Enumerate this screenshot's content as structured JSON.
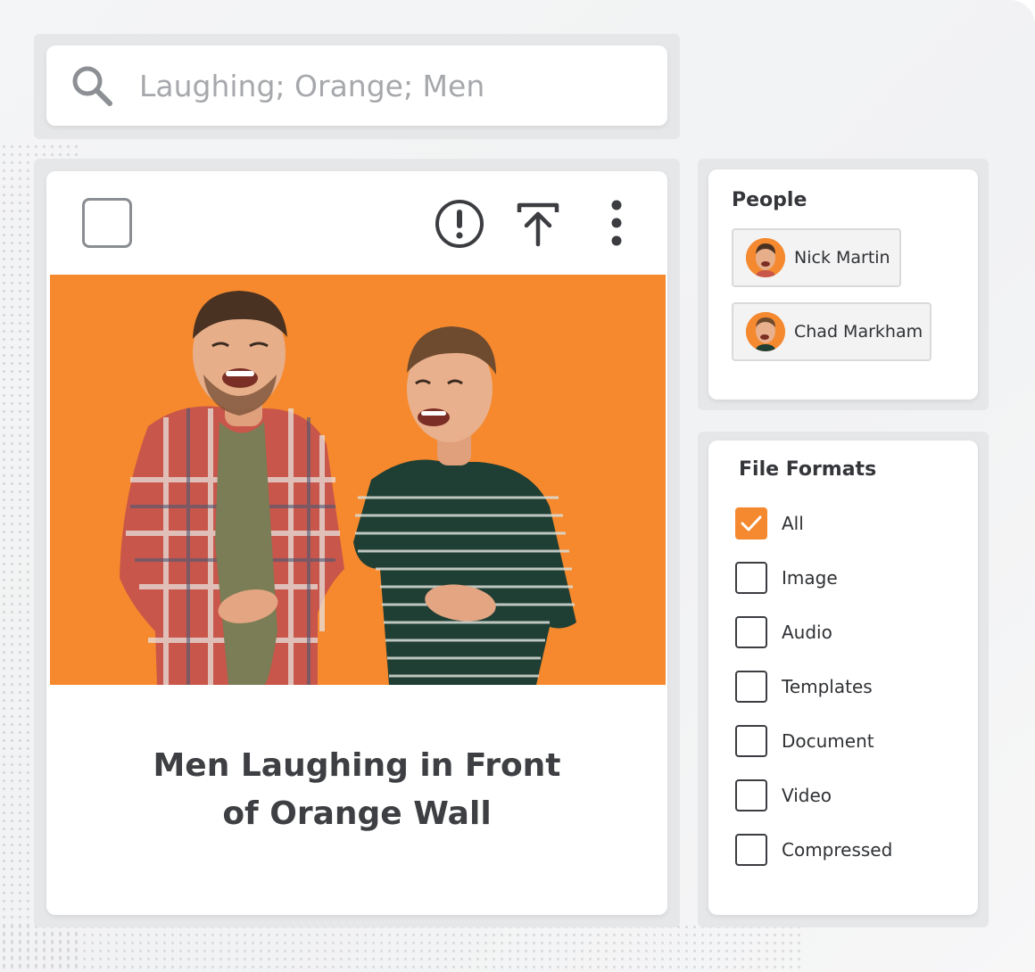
{
  "search": {
    "placeholder": "Laughing; Orange; Men"
  },
  "card": {
    "title": "Men Laughing in Front of Orange Wall",
    "photo_background": "#f6892d"
  },
  "people": {
    "title": "People",
    "items": [
      {
        "name": "Nick Martin"
      },
      {
        "name": "Chad Markham"
      }
    ]
  },
  "formats": {
    "title": "File Formats",
    "options": [
      {
        "label": "All",
        "checked": true
      },
      {
        "label": "Image",
        "checked": false
      },
      {
        "label": "Audio",
        "checked": false
      },
      {
        "label": "Templates",
        "checked": false
      },
      {
        "label": "Document",
        "checked": false
      },
      {
        "label": "Video",
        "checked": false
      },
      {
        "label": "Compressed",
        "checked": false
      }
    ]
  },
  "colors": {
    "accent": "#f4892f",
    "text": "#333333"
  }
}
